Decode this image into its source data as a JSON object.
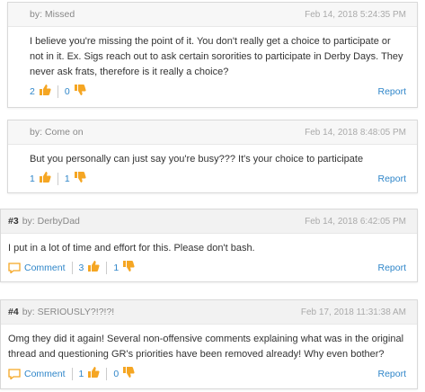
{
  "comments": [
    {
      "number": "",
      "author": "by: Missed",
      "date": "Feb 14, 2018 5:24:35 PM",
      "text": "I believe you're missing the point of it. You don't really get a choice to participate or not in it. Ex. Sigs reach out to ask certain sororities to participate in Derby Days. They never ask frats, therefore is it really a choice?",
      "up": "2",
      "down": "0",
      "report": "Report"
    },
    {
      "number": "",
      "author": "by: Come on",
      "date": "Feb 14, 2018 8:48:05 PM",
      "text": "But you personally can just say you're busy??? It's your choice to participate",
      "up": "1",
      "down": "1",
      "report": "Report"
    },
    {
      "number": "#3",
      "author": "by: DerbyDad",
      "date": "Feb 14, 2018 6:42:05 PM",
      "text": "I put in a lot of time and effort for this. Please don't bash.",
      "comment_label": "Comment",
      "up": "3",
      "down": "1",
      "report": "Report"
    },
    {
      "number": "#4",
      "author": "by: SERIOUSLY?!?!?!",
      "date": "Feb 17, 2018 11:31:38 AM",
      "text": "Omg they did it again! Several non-offensive comments explaining what was in the original thread and questioning GR's priorities have been removed already! Why even bother?",
      "comment_label": "Comment",
      "up": "1",
      "down": "0",
      "report": "Report"
    }
  ],
  "colors": {
    "link": "#2f86c9",
    "thumb_up": "#f5a623",
    "thumb_down": "#f5a623"
  },
  "icons": {
    "up": "thumbs-up-icon",
    "down": "thumbs-down-icon",
    "comment": "speech-bubble-icon"
  }
}
